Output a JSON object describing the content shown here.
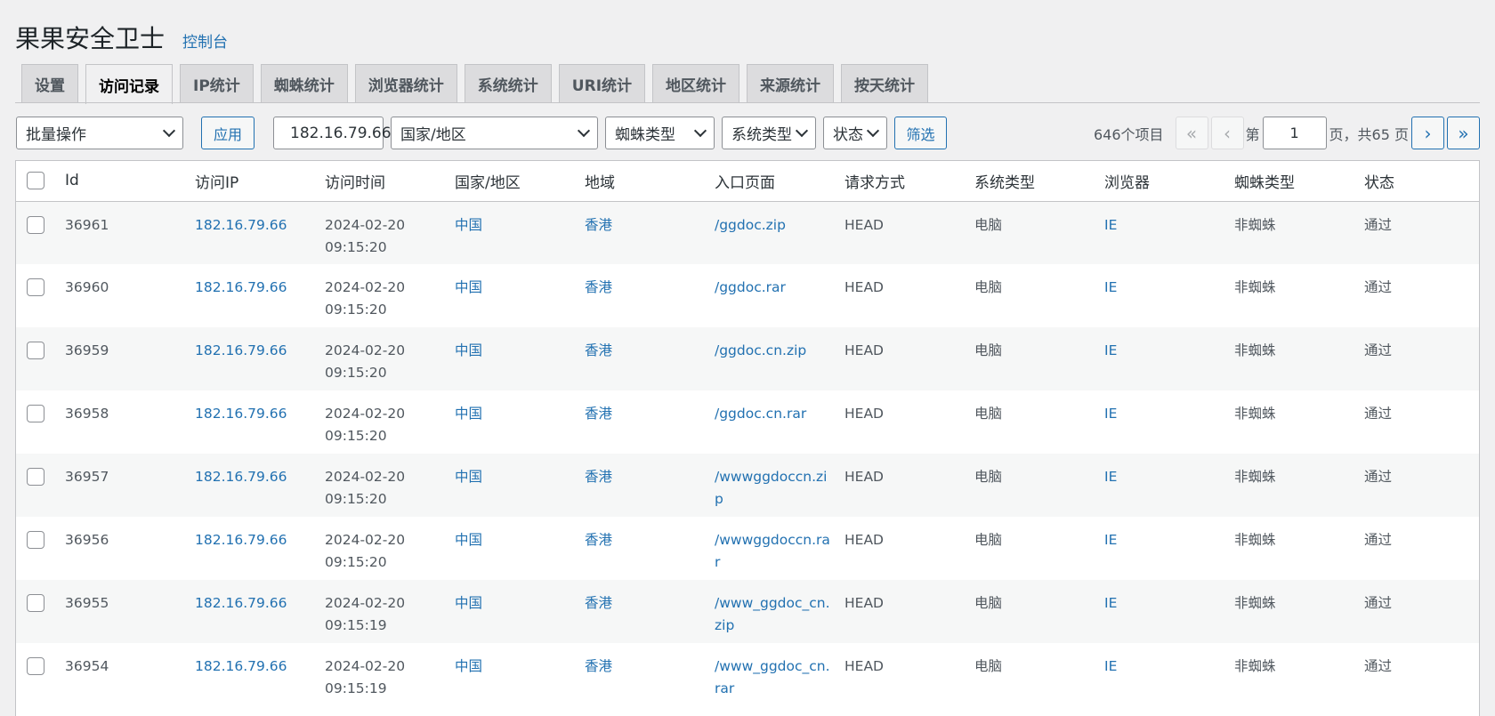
{
  "header": {
    "title": "果果安全卫士",
    "console_link": "控制台"
  },
  "tabs": [
    {
      "label": "设置",
      "active": false
    },
    {
      "label": "访问记录",
      "active": true
    },
    {
      "label": "IP统计",
      "active": false
    },
    {
      "label": "蜘蛛统计",
      "active": false
    },
    {
      "label": "浏览器统计",
      "active": false
    },
    {
      "label": "系统统计",
      "active": false
    },
    {
      "label": "URI统计",
      "active": false
    },
    {
      "label": "地区统计",
      "active": false
    },
    {
      "label": "来源统计",
      "active": false
    },
    {
      "label": "按天统计",
      "active": false
    }
  ],
  "toolbar": {
    "bulk_action": "批量操作",
    "apply": "应用",
    "ip_value": "182.16.79.66",
    "country_select": "国家/地区",
    "spider_select": "蜘蛛类型",
    "system_select": "系统类型",
    "status_select": "状态",
    "filter": "筛选"
  },
  "pagination": {
    "total": "646个项目",
    "first": "«",
    "prev": "‹",
    "page_prefix": "第",
    "current_page": "1",
    "page_suffix": "页，共65 页",
    "next": "›",
    "last": "»"
  },
  "table": {
    "columns": [
      "Id",
      "访问IP",
      "访问时间",
      "国家/地区",
      "地域",
      "入口页面",
      "请求方式",
      "系统类型",
      "浏览器",
      "蜘蛛类型",
      "状态"
    ],
    "rows": [
      {
        "id": "36961",
        "ip": "182.16.79.66",
        "date": "2024-02-20",
        "time": "09:15:20",
        "country": "中国",
        "region": "香港",
        "page": "/ggdoc.zip",
        "method": "HEAD",
        "system": "电脑",
        "browser": "IE",
        "spider": "非蜘蛛",
        "status": "通过"
      },
      {
        "id": "36960",
        "ip": "182.16.79.66",
        "date": "2024-02-20",
        "time": "09:15:20",
        "country": "中国",
        "region": "香港",
        "page": "/ggdoc.rar",
        "method": "HEAD",
        "system": "电脑",
        "browser": "IE",
        "spider": "非蜘蛛",
        "status": "通过"
      },
      {
        "id": "36959",
        "ip": "182.16.79.66",
        "date": "2024-02-20",
        "time": "09:15:20",
        "country": "中国",
        "region": "香港",
        "page": "/ggdoc.cn.zip",
        "method": "HEAD",
        "system": "电脑",
        "browser": "IE",
        "spider": "非蜘蛛",
        "status": "通过"
      },
      {
        "id": "36958",
        "ip": "182.16.79.66",
        "date": "2024-02-20",
        "time": "09:15:20",
        "country": "中国",
        "region": "香港",
        "page": "/ggdoc.cn.rar",
        "method": "HEAD",
        "system": "电脑",
        "browser": "IE",
        "spider": "非蜘蛛",
        "status": "通过"
      },
      {
        "id": "36957",
        "ip": "182.16.79.66",
        "date": "2024-02-20",
        "time": "09:15:20",
        "country": "中国",
        "region": "香港",
        "page": "/wwwggdoccn.zip",
        "method": "HEAD",
        "system": "电脑",
        "browser": "IE",
        "spider": "非蜘蛛",
        "status": "通过"
      },
      {
        "id": "36956",
        "ip": "182.16.79.66",
        "date": "2024-02-20",
        "time": "09:15:20",
        "country": "中国",
        "region": "香港",
        "page": "/wwwggdoccn.rar",
        "method": "HEAD",
        "system": "电脑",
        "browser": "IE",
        "spider": "非蜘蛛",
        "status": "通过"
      },
      {
        "id": "36955",
        "ip": "182.16.79.66",
        "date": "2024-02-20",
        "time": "09:15:19",
        "country": "中国",
        "region": "香港",
        "page": "/www_ggdoc_cn.zip",
        "method": "HEAD",
        "system": "电脑",
        "browser": "IE",
        "spider": "非蜘蛛",
        "status": "通过"
      },
      {
        "id": "36954",
        "ip": "182.16.79.66",
        "date": "2024-02-20",
        "time": "09:15:19",
        "country": "中国",
        "region": "香港",
        "page": "/www_ggdoc_cn.rar",
        "method": "HEAD",
        "system": "电脑",
        "browser": "IE",
        "spider": "非蜘蛛",
        "status": "通过"
      }
    ]
  }
}
